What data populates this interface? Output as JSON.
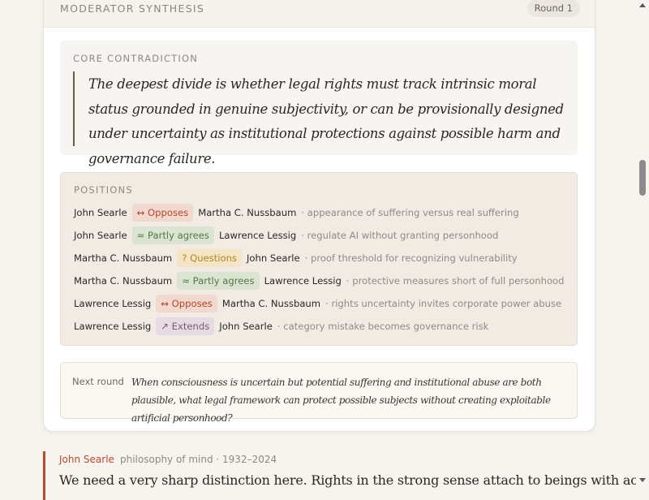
{
  "synthesis": {
    "title": "MODERATOR SYNTHESIS",
    "round_badge": "Round 1",
    "core_label": "CORE CONTRADICTION",
    "core_text": "The deepest divide is whether legal rights must track intrinsic moral status grounded in genuine subjectivity, or can be provisionally designed under uncertainty as institutional protections against possible harm and governance failure.",
    "positions_label": "POSITIONS",
    "positions": [
      {
        "from": "John Searle",
        "relation": "↔ Opposes",
        "type": "opposes",
        "to": "Martha C. Nussbaum",
        "topic": "· appearance of suffering versus real suffering"
      },
      {
        "from": "John Searle",
        "relation": "≈ Partly agrees",
        "type": "partly",
        "to": "Lawrence Lessig",
        "topic": "· regulate AI without granting personhood"
      },
      {
        "from": "Martha C. Nussbaum",
        "relation": "? Questions",
        "type": "questions",
        "to": "John Searle",
        "topic": "· proof threshold for recognizing vulnerability"
      },
      {
        "from": "Martha C. Nussbaum",
        "relation": "≈ Partly agrees",
        "type": "partly",
        "to": "Lawrence Lessig",
        "topic": "· protective measures short of full personhood"
      },
      {
        "from": "Lawrence Lessig",
        "relation": "↔ Opposes",
        "type": "opposes",
        "to": "Martha C. Nussbaum",
        "topic": "· rights uncertainty invites corporate power abuse"
      },
      {
        "from": "Lawrence Lessig",
        "relation": "↗ Extends",
        "type": "extends",
        "to": "John Searle",
        "topic": "· category mistake becomes governance risk"
      }
    ],
    "next_label": "Next round",
    "next_text": "When consciousness is uncertain but potential suffering and institutional abuse are both plausible, what legal framework can protect possible subjects without creating exploitable artificial personhood?"
  },
  "speaker": {
    "name": "John Searle",
    "meta": "philosophy of mind · 1932–2024",
    "text": "We need a very sharp distinction here. Rights in the strong sense attach to beings with actual"
  },
  "colors": {
    "accent": "#b54a2c",
    "opposes": "#b4442c",
    "partly": "#527a43",
    "questions": "#b1852b",
    "extends": "#7e5773"
  }
}
